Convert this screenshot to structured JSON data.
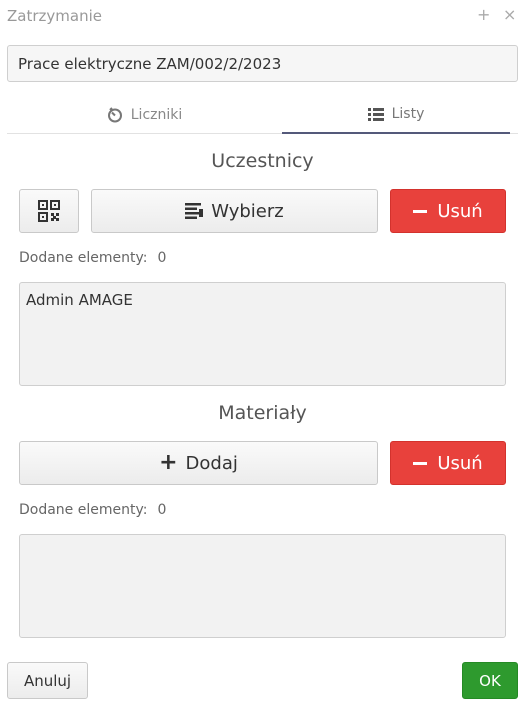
{
  "window": {
    "title": "Zatrzymanie"
  },
  "name_field": {
    "value": "Prace elektryczne ZAM/002/2/2023"
  },
  "tabs": [
    {
      "label": "Liczniki",
      "icon": "timer-icon",
      "active": false
    },
    {
      "label": "Listy",
      "icon": "list-icon",
      "active": true
    }
  ],
  "participants": {
    "title": "Uczestnicy",
    "qr_icon": "qr-code-icon",
    "select_label": "Wybierz",
    "remove_label": "Usuń",
    "count_label": "Dodane elementy:",
    "count": "0",
    "items": [
      "Admin AMAGE"
    ]
  },
  "materials": {
    "title": "Materiały",
    "add_label": "Dodaj",
    "remove_label": "Usuń",
    "count_label": "Dodane elementy:",
    "count": "0",
    "items": []
  },
  "footer": {
    "cancel_label": "Anuluj",
    "ok_label": "OK"
  },
  "colors": {
    "danger": "#e8413c",
    "success": "#2e9a2e",
    "tab_active": "#54597a"
  }
}
